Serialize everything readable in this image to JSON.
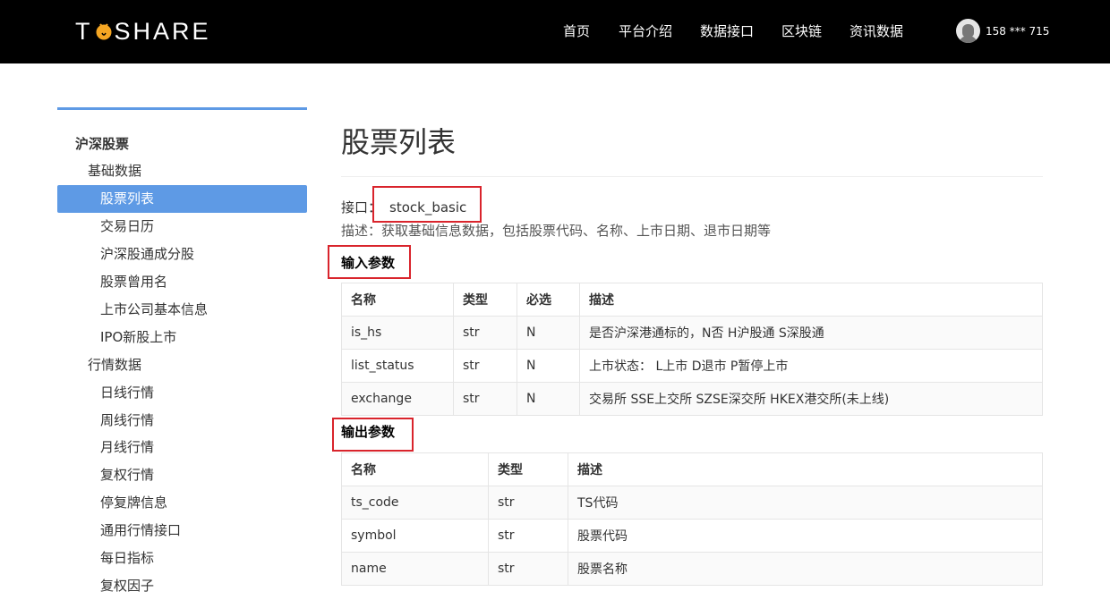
{
  "header": {
    "logo_left": "T",
    "logo_right": "SHARE",
    "nav": [
      {
        "label": "首页"
      },
      {
        "label": "平台介绍"
      },
      {
        "label": "数据接口"
      },
      {
        "label": "区块链"
      },
      {
        "label": "资讯数据"
      }
    ],
    "user": "158 *** 715"
  },
  "sidebar": {
    "items": [
      {
        "label": "沪深股票",
        "level": 0
      },
      {
        "label": "基础数据",
        "level": 1
      },
      {
        "label": "股票列表",
        "level": 2,
        "active": true
      },
      {
        "label": "交易日历",
        "level": 2
      },
      {
        "label": "沪深股通成分股",
        "level": 2
      },
      {
        "label": "股票曾用名",
        "level": 2
      },
      {
        "label": "上市公司基本信息",
        "level": 2
      },
      {
        "label": "IPO新股上市",
        "level": 2
      },
      {
        "label": "行情数据",
        "level": 1
      },
      {
        "label": "日线行情",
        "level": 2
      },
      {
        "label": "周线行情",
        "level": 2
      },
      {
        "label": "月线行情",
        "level": 2
      },
      {
        "label": "复权行情",
        "level": 2
      },
      {
        "label": "停复牌信息",
        "level": 2
      },
      {
        "label": "通用行情接口",
        "level": 2
      },
      {
        "label": "每日指标",
        "level": 2
      },
      {
        "label": "复权因子",
        "level": 2
      }
    ]
  },
  "main": {
    "title": "股票列表",
    "interface_label": "接口：",
    "interface_name": "stock_basic",
    "description": "描述：获取基础信息数据，包括股票代码、名称、上市日期、退市日期等",
    "input_title": "输入参数",
    "input_headers": [
      "名称",
      "类型",
      "必选",
      "描述"
    ],
    "input_rows": [
      [
        "is_hs",
        "str",
        "N",
        "是否沪深港通标的，N否 H沪股通 S深股通"
      ],
      [
        "list_status",
        "str",
        "N",
        "上市状态： L上市 D退市 P暂停上市"
      ],
      [
        "exchange",
        "str",
        "N",
        "交易所 SSE上交所 SZSE深交所 HKEX港交所(未上线)"
      ]
    ],
    "output_title": "输出参数",
    "output_headers": [
      "名称",
      "类型",
      "描述"
    ],
    "output_rows": [
      [
        "ts_code",
        "str",
        "TS代码"
      ],
      [
        "symbol",
        "str",
        "股票代码"
      ],
      [
        "name",
        "str",
        "股票名称"
      ]
    ]
  },
  "colors": {
    "topbar": "#000000",
    "accent": "#5e9ae5",
    "highlight_box": "#d9242c",
    "logo_dot": "#f5a623"
  }
}
